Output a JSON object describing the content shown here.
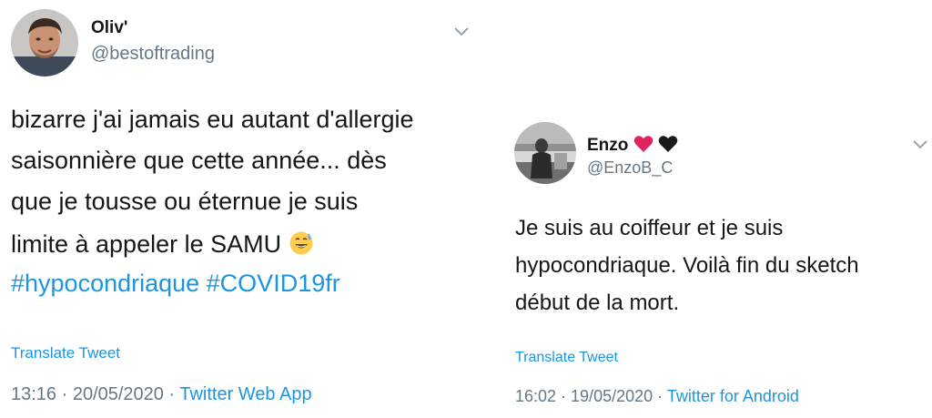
{
  "tweets": [
    {
      "display_name": "Oliv'",
      "handle": "@bestoftrading",
      "lines": [
        "bizarre j'ai jamais eu autant d'allergie",
        "saisonnière que cette année... dès",
        "que je tousse ou éternue je suis",
        "limite à appeler le SAMU"
      ],
      "hashtags": "#hypocondriaque #COVID19fr",
      "emoji": "grinning-sweat-emoji",
      "translate_label": "Translate Tweet",
      "timestamp": "13:16 · 20/05/2020 · ",
      "source": "Twitter Web App"
    },
    {
      "display_name": "Enzo",
      "handle": "@EnzoB_C",
      "name_emojis": [
        "red-heart-emoji",
        "black-heart-emoji"
      ],
      "lines": [
        "Je suis au coiffeur et je suis",
        "hypocondriaque. Voilà fin du sketch",
        "début de la mort."
      ],
      "translate_label": "Translate Tweet",
      "timestamp": "16:02 · 19/05/2020 · ",
      "source": "Twitter for Android"
    }
  ],
  "colors": {
    "link": "#1b95e0",
    "secondary": "#657786",
    "text": "#14171a"
  },
  "icons": {
    "caret": "chevron-down-icon"
  }
}
